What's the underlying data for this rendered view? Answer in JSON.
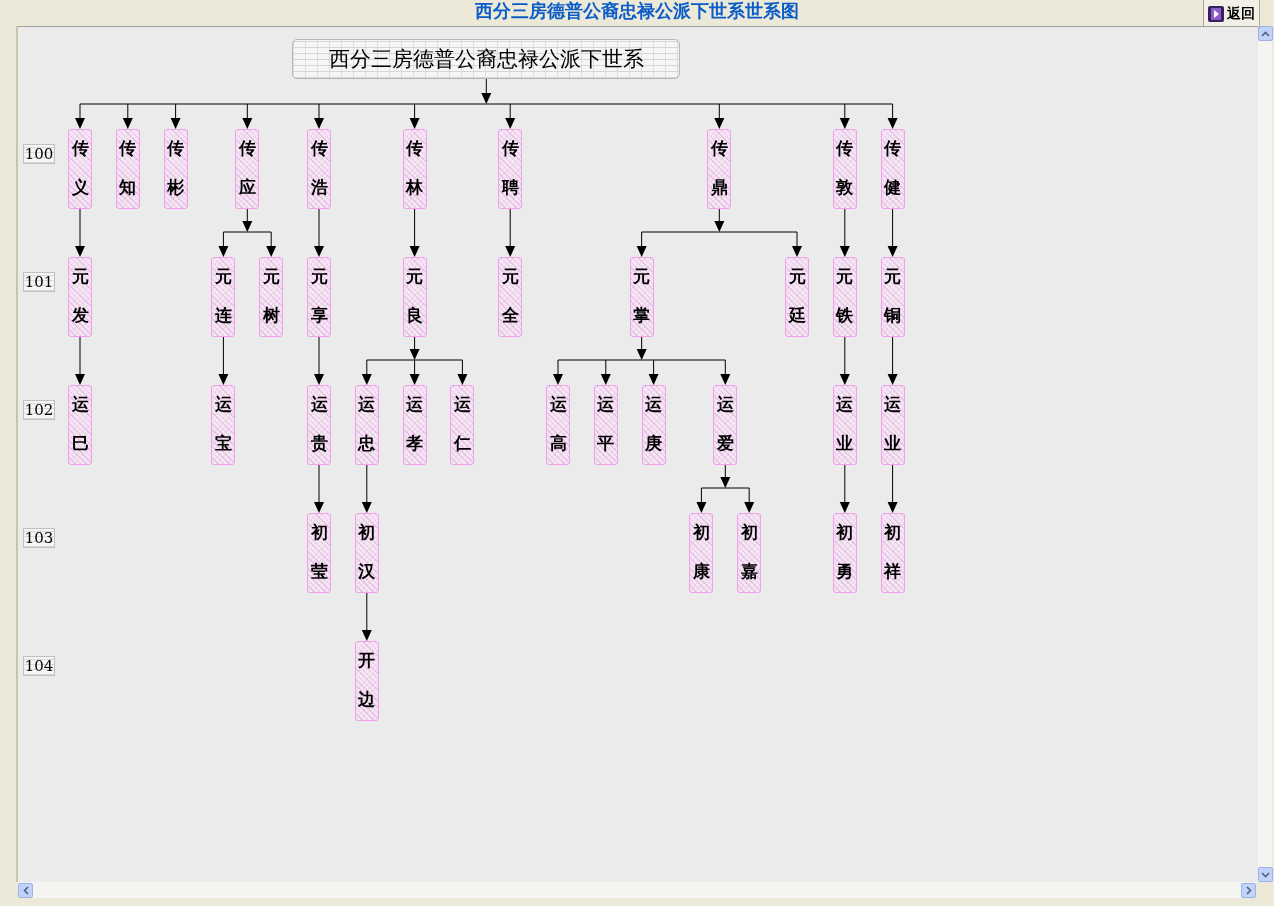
{
  "window": {
    "title": "西分三房德普公裔忠禄公派下世系世系图",
    "back_button": "返回"
  },
  "tree": {
    "title": "西分三房德普公裔忠禄公派下世系",
    "generations": [
      "100",
      "101",
      "102",
      "103",
      "104"
    ],
    "children": [
      {
        "name": "传义",
        "children": [
          {
            "name": "元发",
            "children": [
              {
                "name": "运巳"
              }
            ]
          }
        ]
      },
      {
        "name": "传知"
      },
      {
        "name": "传彬"
      },
      {
        "name": "传应",
        "children": [
          {
            "name": "元连",
            "children": [
              {
                "name": "运宝"
              }
            ]
          },
          {
            "name": "元树"
          }
        ]
      },
      {
        "name": "传浩",
        "children": [
          {
            "name": "元享",
            "children": [
              {
                "name": "运贵",
                "children": [
                  {
                    "name": "初莹"
                  }
                ]
              }
            ]
          }
        ]
      },
      {
        "name": "传林",
        "children": [
          {
            "name": "元良",
            "children": [
              {
                "name": "运忠",
                "children": [
                  {
                    "name": "初汉",
                    "children": [
                      {
                        "name": "开边"
                      }
                    ]
                  }
                ]
              },
              {
                "name": "运孝"
              },
              {
                "name": "运仁"
              }
            ]
          }
        ]
      },
      {
        "name": "传聘",
        "children": [
          {
            "name": "元全"
          }
        ]
      },
      {
        "name": "传鼎",
        "children": [
          {
            "name": "元掌",
            "children": [
              {
                "name": "运高"
              },
              {
                "name": "运平"
              },
              {
                "name": "运庚"
              },
              {
                "name": "运爱",
                "children": [
                  {
                    "name": "初康"
                  },
                  {
                    "name": "初嘉"
                  }
                ]
              }
            ]
          },
          {
            "name": "元廷"
          }
        ]
      },
      {
        "name": "传敦",
        "children": [
          {
            "name": "元铁",
            "children": [
              {
                "name": "运业",
                "children": [
                  {
                    "name": "初勇"
                  }
                ]
              }
            ]
          }
        ]
      },
      {
        "name": "传健",
        "children": [
          {
            "name": "元铜",
            "children": [
              {
                "name": "运业",
                "children": [
                  {
                    "name": "初祥"
                  }
                ]
              }
            ]
          }
        ]
      }
    ]
  }
}
